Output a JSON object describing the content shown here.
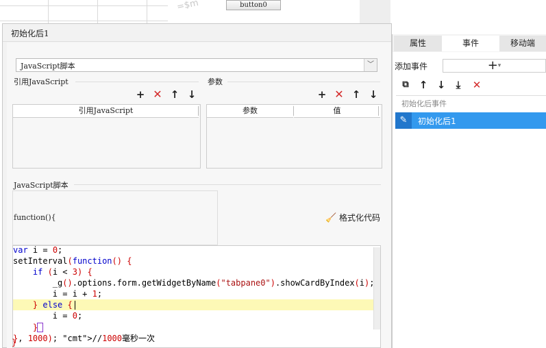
{
  "background": {
    "watermark": "=$m",
    "button_label": "button0"
  },
  "dialog": {
    "title": "初始化后1",
    "script_type_select": "JavaScript脚本",
    "ref_js_section": "引用JavaScript",
    "params_section": "参数",
    "ref_js_table": {
      "columns": [
        "引用JavaScript"
      ],
      "rows": []
    },
    "params_table": {
      "columns": [
        "参数",
        "值"
      ],
      "rows": []
    },
    "script_section": "JavaScript脚本",
    "function_header": "function(){",
    "format_button": "格式化代码",
    "code_lines": [
      "var i = 0;",
      "setInterval(function() {",
      "    if (i < 3) {",
      "        _g().options.form.getWidgetByName(\"tabpane0\").showCardByIndex(i);",
      "        i = i + 1;",
      "    } else {",
      "        i = 0;",
      "    }",
      "}, 1000); //1000毫秒一次",
      "}"
    ]
  },
  "right_panel": {
    "tabs": [
      "属性",
      "事件",
      "移动端"
    ],
    "active_tab": "事件",
    "add_event_label": "添加事件",
    "add_event_icon": "+",
    "toolbar_icons": [
      "copy-icon",
      "arrow-up-icon",
      "arrow-down-icon",
      "move-bottom-icon",
      "delete-icon"
    ],
    "event_group": "初始化后事件",
    "events": [
      "初始化后1"
    ]
  },
  "colors": {
    "selection_blue": "#3399ee",
    "delete_red": "#d42a2a",
    "current_line_yellow": "#fdf9b6"
  }
}
